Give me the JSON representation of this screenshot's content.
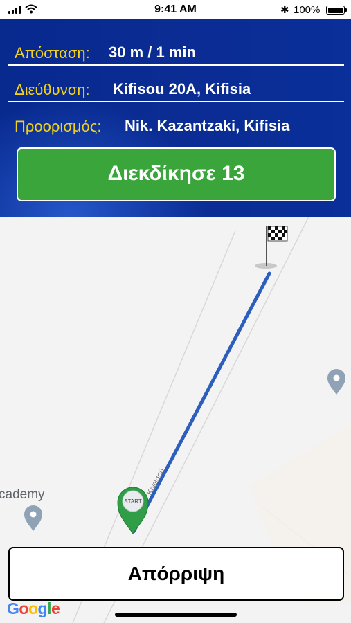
{
  "status_bar": {
    "time": "9:41 AM",
    "battery": "100%"
  },
  "trip": {
    "distance_label": "Απόσταση:",
    "distance_value": "30 m / 1 min",
    "address_label": "Διεύθυνση:",
    "address_value": "Kifisou 20A, Kifisia",
    "destination_label": "Προορισμός:",
    "destination_value": "Nik. Kazantzaki, Kifisia"
  },
  "actions": {
    "claim_label": "Διεκδίκησε 13",
    "reject_label": "Απόρριψη"
  },
  "map": {
    "poi_label": "cademy",
    "street_label": "Κηφισού",
    "start_marker_label": "START",
    "attribution": [
      "G",
      "o",
      "o",
      "g",
      "l",
      "e"
    ],
    "colors": {
      "route": "#2c5fbd",
      "start_marker": "#2f9e46",
      "poi": "#8fa2b6"
    }
  },
  "colors": {
    "header_bg": "#0a2c94",
    "label": "#f2d21b",
    "claim_bg": "#3aa53b"
  }
}
